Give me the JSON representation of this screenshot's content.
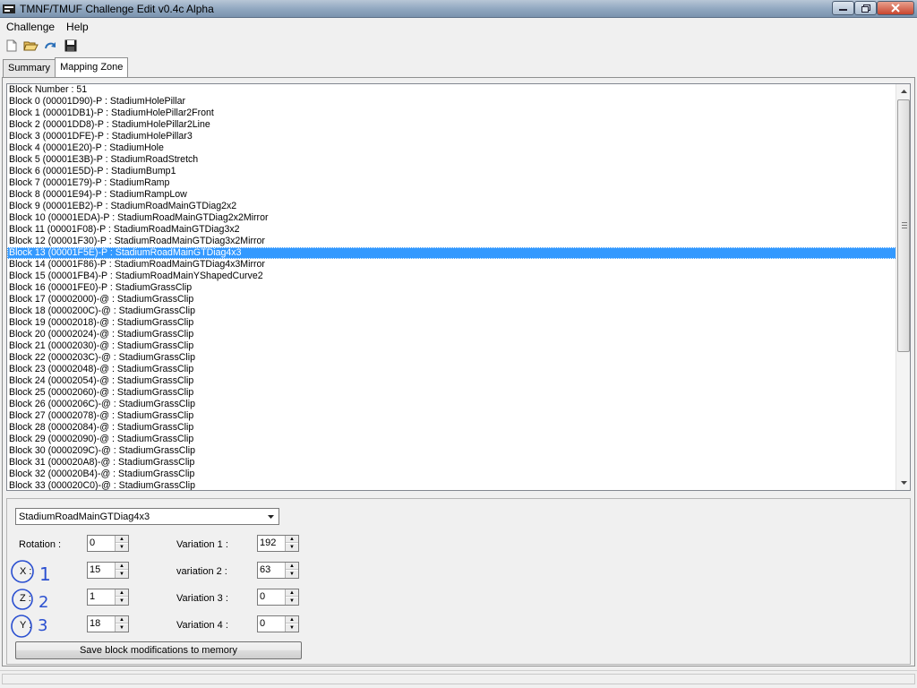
{
  "window": {
    "title": "TMNF/TMUF Challenge Edit v0.4c Alpha"
  },
  "menu": [
    {
      "label": "Challenge"
    },
    {
      "label": "Help"
    }
  ],
  "toolbar": [
    "new-file-icon",
    "open-folder-icon",
    "refresh-icon",
    "save-disk-icon"
  ],
  "tabs": [
    {
      "label": "Summary",
      "active": false
    },
    {
      "label": "Mapping Zone",
      "active": true
    }
  ],
  "blocks": {
    "header": "Block Number : 51",
    "selected_index": 13,
    "items": [
      "Block 0 (00001D90)-P : StadiumHolePillar",
      "Block 1 (00001DB1)-P : StadiumHolePillar2Front",
      "Block 2 (00001DD8)-P : StadiumHolePillar2Line",
      "Block 3 (00001DFE)-P : StadiumHolePillar3",
      "Block 4 (00001E20)-P : StadiumHole",
      "Block 5 (00001E3B)-P : StadiumRoadStretch",
      "Block 6 (00001E5D)-P : StadiumBump1",
      "Block 7 (00001E79)-P : StadiumRamp",
      "Block 8 (00001E94)-P : StadiumRampLow",
      "Block 9 (00001EB2)-P : StadiumRoadMainGTDiag2x2",
      "Block 10 (00001EDA)-P : StadiumRoadMainGTDiag2x2Mirror",
      "Block 11 (00001F08)-P : StadiumRoadMainGTDiag3x2",
      "Block 12 (00001F30)-P : StadiumRoadMainGTDiag3x2Mirror",
      "Block 13 (00001F5E)-P : StadiumRoadMainGTDiag4x3",
      "Block 14 (00001F86)-P : StadiumRoadMainGTDiag4x3Mirror",
      "Block 15 (00001FB4)-P : StadiumRoadMainYShapedCurve2",
      "Block 16 (00001FE0)-P : StadiumGrassClip",
      "Block 17 (00002000)-@ : StadiumGrassClip",
      "Block 18 (0000200C)-@ : StadiumGrassClip",
      "Block 19 (00002018)-@ : StadiumGrassClip",
      "Block 20 (00002024)-@ : StadiumGrassClip",
      "Block 21 (00002030)-@ : StadiumGrassClip",
      "Block 22 (0000203C)-@ : StadiumGrassClip",
      "Block 23 (00002048)-@ : StadiumGrassClip",
      "Block 24 (00002054)-@ : StadiumGrassClip",
      "Block 25 (00002060)-@ : StadiumGrassClip",
      "Block 26 (0000206C)-@ : StadiumGrassClip",
      "Block 27 (00002078)-@ : StadiumGrassClip",
      "Block 28 (00002084)-@ : StadiumGrassClip",
      "Block 29 (00002090)-@ : StadiumGrassClip",
      "Block 30 (0000209C)-@ : StadiumGrassClip",
      "Block 31 (000020A8)-@ : StadiumGrassClip",
      "Block 32 (000020B4)-@ : StadiumGrassClip",
      "Block 33 (000020C0)-@ : StadiumGrassClip"
    ]
  },
  "editor": {
    "block_type": "StadiumRoadMainGTDiag4x3",
    "left_fields": [
      {
        "label": "Rotation :",
        "value": "0"
      },
      {
        "label": "X :",
        "value": "15"
      },
      {
        "label": "Z :",
        "value": "1"
      },
      {
        "label": "Y :",
        "value": "18"
      }
    ],
    "right_fields": [
      {
        "label": "Variation 1 :",
        "value": "192"
      },
      {
        "label": "variation 2 :",
        "value": "63"
      },
      {
        "label": "Variation 3 :",
        "value": "0"
      },
      {
        "label": "Variation 4 :",
        "value": "0"
      }
    ],
    "save_label": "Save block modifications to memory"
  },
  "annotation": {
    "numbers": [
      "1",
      "2",
      "3"
    ],
    "color": "#2a4fd0"
  }
}
